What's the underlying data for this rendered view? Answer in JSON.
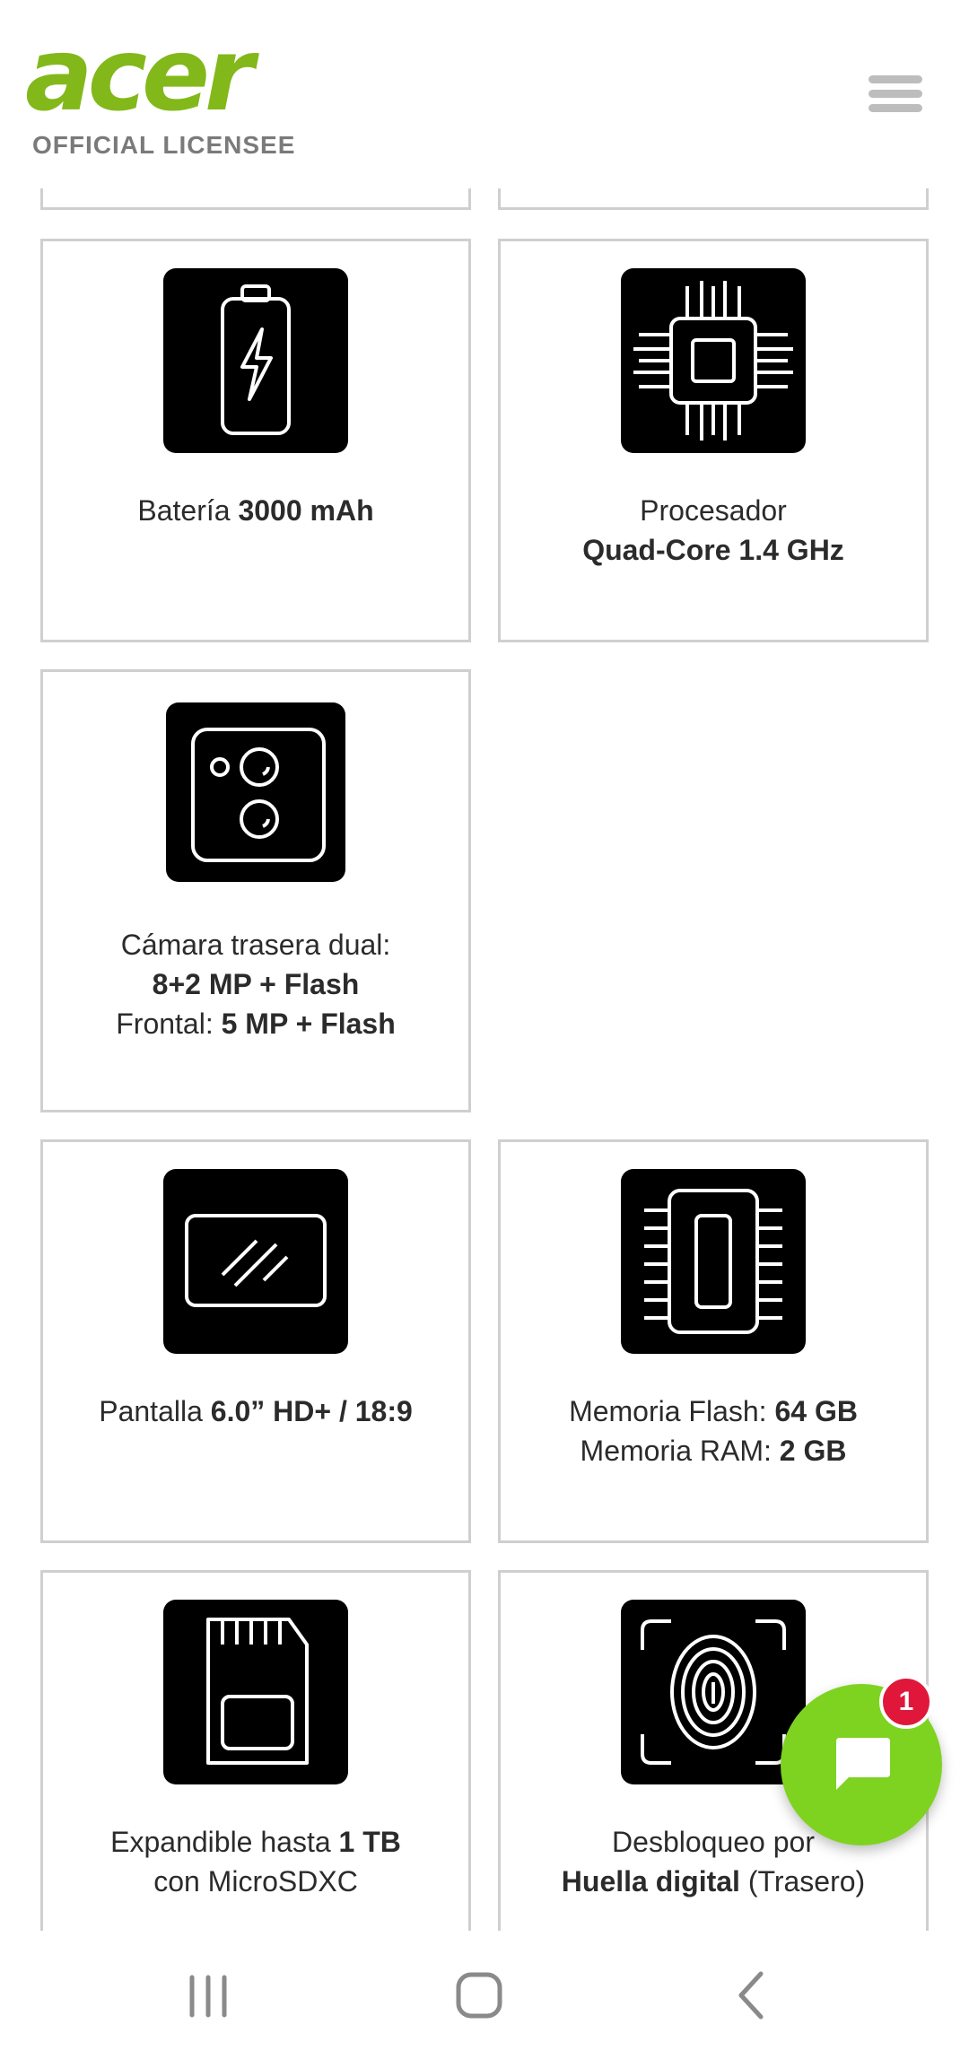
{
  "header": {
    "brand": "acer",
    "tagline": "OFFICIAL LICENSEE",
    "menu_icon": "hamburger-menu-icon"
  },
  "specs": [
    {
      "icon": "battery-icon",
      "pre": "Batería ",
      "bold": "3000 mAh"
    },
    {
      "icon": "processor-chip-icon",
      "pre": "Procesador",
      "bold": "Quad-Core 1.4 GHz"
    },
    {
      "icon": "dual-camera-icon",
      "line1": "Cámara trasera dual:",
      "line2": "8+2 MP + Flash",
      "line3_pre": "Frontal: ",
      "line3_bold": "5 MP + Flash"
    },
    {
      "icon": "screen-icon",
      "pre": "Pantalla ",
      "bold": "6.0” HD+ / 18:9"
    },
    {
      "icon": "memory-icon",
      "line1_pre": "Memoria Flash: ",
      "line1_bold": "64 GB",
      "line2_pre": "Memoria RAM: ",
      "line2_bold": "2 GB"
    },
    {
      "icon": "sd-card-icon",
      "line1_pre": "Expandible hasta ",
      "line1_bold": "1 TB",
      "line2": "con MicroSDXC"
    },
    {
      "icon": "fingerprint-icon",
      "line1": "Desbloqueo por",
      "line2_bold": "Huella digital",
      "line2_post": " (Trasero)"
    }
  ],
  "chat": {
    "icon": "chat-bubble-icon",
    "badge_count": "1",
    "accent": "#7ed321",
    "badge_color": "#e0173a"
  },
  "navbar": {
    "recents": "recent-apps-icon",
    "home": "home-icon",
    "back": "back-icon"
  },
  "colors": {
    "brand_green": "#83b81a",
    "border": "#cfcfcf"
  }
}
